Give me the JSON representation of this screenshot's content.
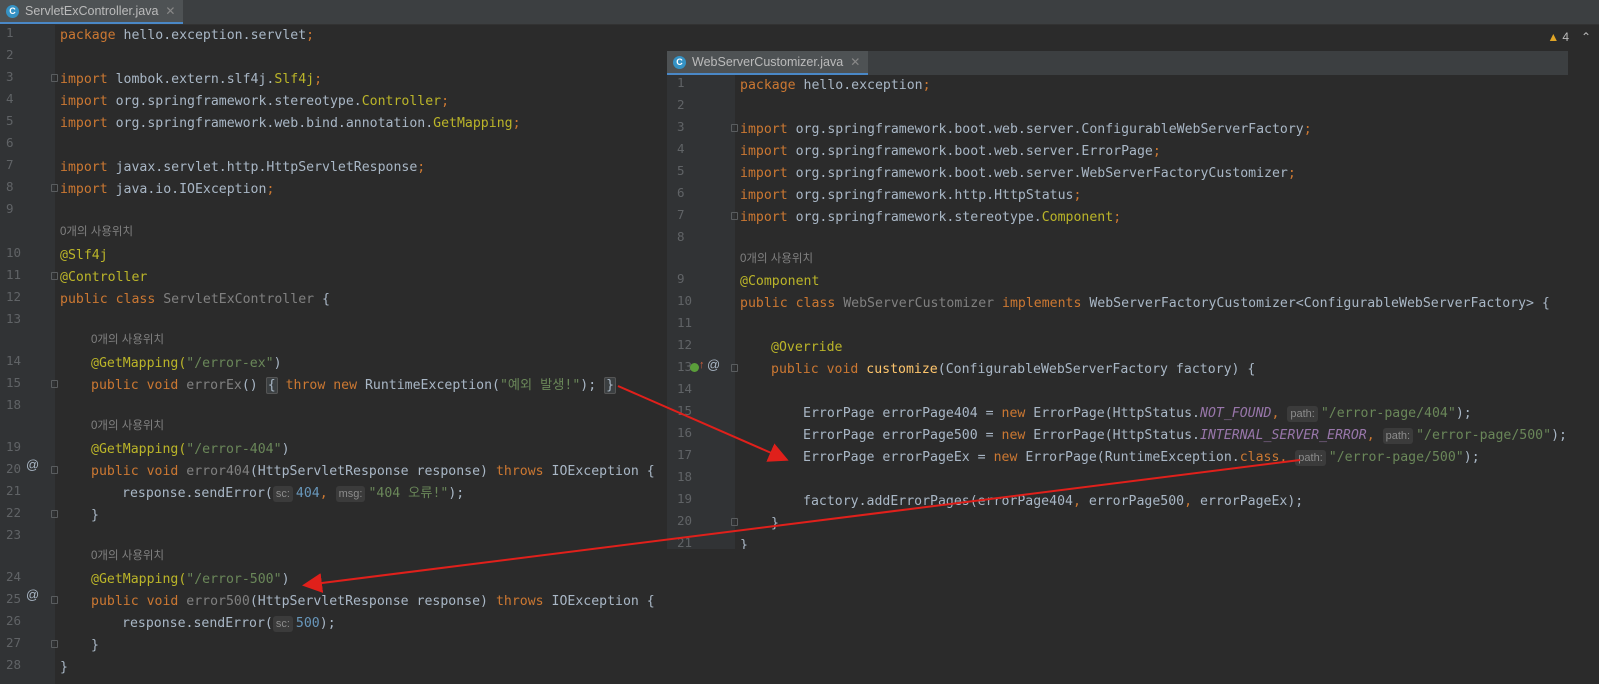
{
  "left_tab": {
    "label": "ServletExController.java",
    "icon": "class-icon"
  },
  "right_tab": {
    "label": "WebServerCustomizer.java",
    "icon": "class-icon"
  },
  "inspection_count": "4",
  "usage_hint": "0개의 사용위치",
  "left_lines": [
    [
      "1",
      "pkg"
    ],
    [
      "2",
      ""
    ],
    [
      "3",
      "imp"
    ],
    [
      "4",
      ""
    ],
    [
      "5",
      ""
    ],
    [
      "6",
      ""
    ],
    [
      "7",
      ""
    ],
    [
      "8",
      ""
    ],
    [
      "9",
      ""
    ],
    [
      "10",
      ""
    ],
    [
      "11",
      ""
    ],
    [
      "12",
      ""
    ],
    [
      "13",
      ""
    ],
    [
      "14",
      ""
    ],
    [
      "15",
      ""
    ],
    [
      "18",
      ""
    ],
    [
      "19",
      ""
    ],
    [
      "20",
      ""
    ],
    [
      "21",
      ""
    ],
    [
      "22",
      ""
    ],
    [
      "23",
      ""
    ],
    [
      "24",
      ""
    ],
    [
      "25",
      ""
    ],
    [
      "26",
      ""
    ],
    [
      "27",
      ""
    ],
    [
      "28",
      ""
    ]
  ],
  "left_code": {
    "l1": "package hello.exception.servlet;",
    "l3a": "import lombok.extern.slf4j.",
    "l3b": "Slf4j",
    "l3c": ";",
    "l4a": "import org.springframework.stereotype.",
    "l4b": "Controller",
    "l4c": ";",
    "l5a": "import org.springframework.web.bind.annotation.",
    "l5b": "GetMapping",
    "l5c": ";",
    "l7": "import javax.servlet.http.HttpServletResponse;",
    "l8": "import java.io.IOException;",
    "l10": "@Slf4j",
    "l11": "@Controller",
    "l12a": "public class ",
    "l12b": "ServletExController",
    "l12c": " {",
    "l14a": "@GetMapping(",
    "l14b": "\"/error-ex\"",
    "l14c": ")",
    "l15a": "public void ",
    "l15b": "errorEx",
    "l15c": "() ",
    "l15d": "{",
    "l15e": " throw new ",
    "l15f": "RuntimeException(",
    "l15g": "\"예외 발생!\"",
    "l15h": "); ",
    "l15i": "}",
    "l19a": "@GetMapping(",
    "l19b": "\"/error-404\"",
    "l19c": ")",
    "l20a": "public void ",
    "l20b": "error404",
    "l20c": "(HttpServletResponse response) ",
    "l20d": "throws ",
    "l20e": "IOException {",
    "l21a": "response.sendError(",
    "l21b": "sc:",
    "l21c": "404",
    "l21d": ", ",
    "l21e": "msg:",
    "l21f": "\"404 오류!\"",
    "l21g": ");",
    "l22": "}",
    "l24a": "@GetMapping(",
    "l24b": "\"/error-500\"",
    "l24c": ")",
    "l25a": "public void ",
    "l25b": "error500",
    "l25c": "(HttpServletResponse response) ",
    "l25d": "throws ",
    "l25e": "IOException {",
    "l26a": "response.sendError(",
    "l26b": "sc:",
    "l26c": "500",
    "l26d": ");",
    "l27": "}",
    "l28": "}"
  },
  "right_code": {
    "l1": "package hello.exception;",
    "l3": "import org.springframework.boot.web.server.ConfigurableWebServerFactory;",
    "l4": "import org.springframework.boot.web.server.ErrorPage;",
    "l5": "import org.springframework.boot.web.server.WebServerFactoryCustomizer;",
    "l6": "import org.springframework.http.HttpStatus;",
    "l7a": "import org.springframework.stereotype.",
    "l7b": "Component",
    "l7c": ";",
    "l9": "@Component",
    "l10a": "public class ",
    "l10b": "WebServerCustomizer",
    "l10c": " implements ",
    "l10d": "WebServerFactoryCustomizer<ConfigurableWebServerFactory> {",
    "l12": "@Override",
    "l13a": "public void ",
    "l13b": "customize",
    "l13c": "(ConfigurableWebServerFactory factory) {",
    "l15a": "ErrorPage errorPage404 = ",
    "l15b": "new ",
    "l15c": "ErrorPage(HttpStatus.",
    "l15d": "NOT_FOUND",
    "l15e": ", ",
    "l15f": "path:",
    "l15g": "\"/error-page/404\"",
    "l15h": ");",
    "l16a": "ErrorPage errorPage500 = ",
    "l16b": "new ",
    "l16c": "ErrorPage(HttpStatus.",
    "l16d": "INTERNAL_SERVER_ERROR",
    "l16e": ", ",
    "l16f": "path:",
    "l16g": "\"/error-page/500\"",
    "l16h": ");",
    "l17a": "ErrorPage errorPageEx = ",
    "l17b": "new ",
    "l17c": "ErrorPage(RuntimeException.",
    "l17d": "class",
    "l17e": ", ",
    "l17f": "path:",
    "l17g": "\"/error-page/500\"",
    "l17h": ");",
    "l19a": "factory.addErrorPages(errorPage404",
    "l19b": ", ",
    "l19c": "errorPage500",
    "l19d": ", ",
    "l19e": "errorPageEx);",
    "l20": "}",
    "l21": "}"
  },
  "right_line_numbers": [
    "1",
    "2",
    "3",
    "4",
    "5",
    "6",
    "7",
    "8",
    "9",
    "10",
    "11",
    "12",
    "13",
    "14",
    "15",
    "16",
    "17",
    "18",
    "19",
    "20",
    "21"
  ],
  "colors": {
    "arrow": "#e0201b",
    "accent": "#4a88c7"
  }
}
